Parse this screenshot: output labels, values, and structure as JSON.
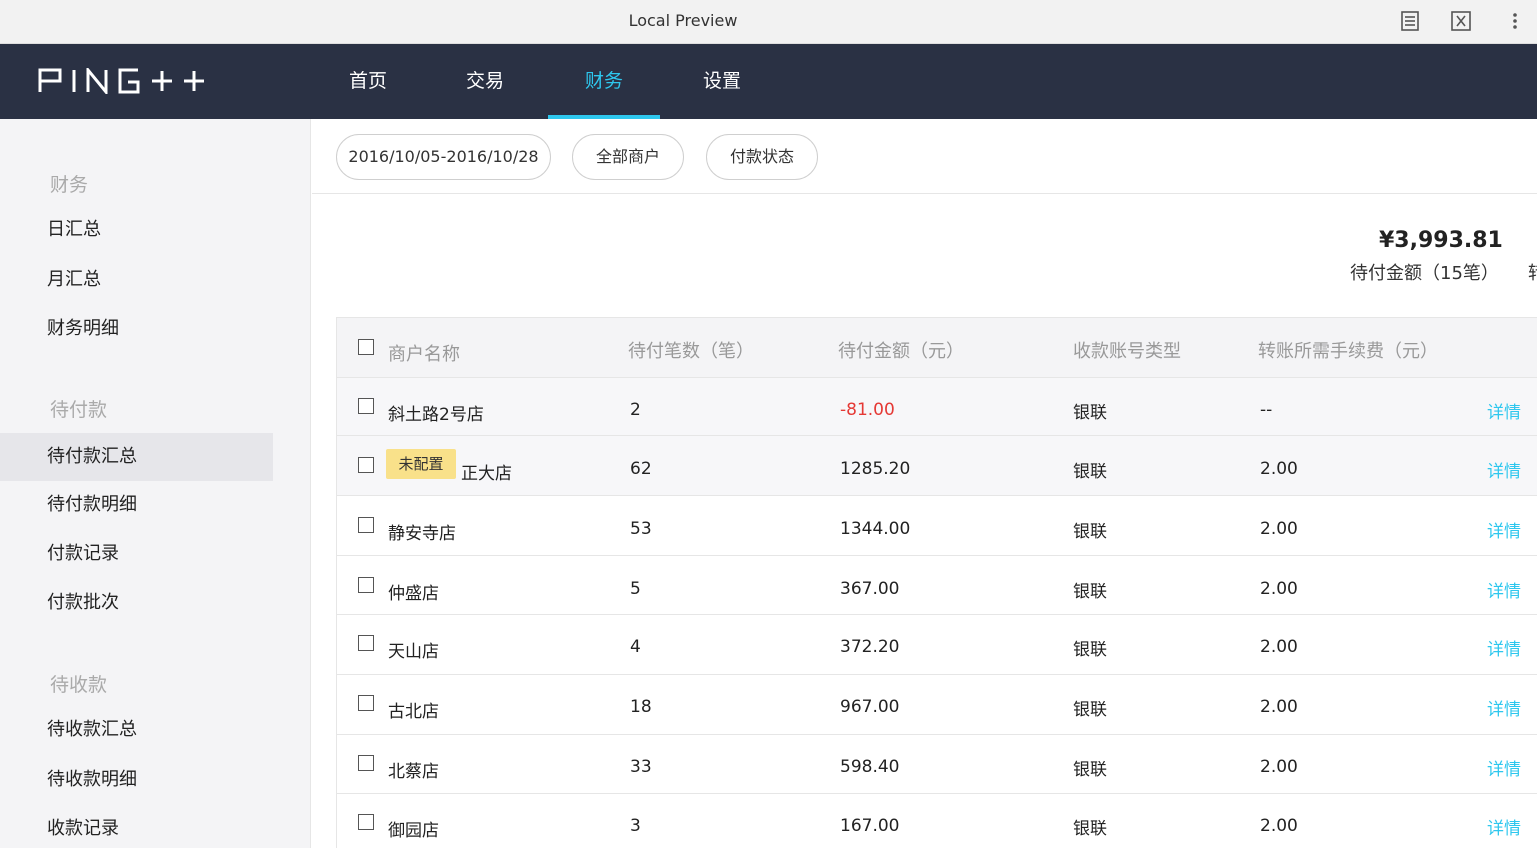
{
  "browser": {
    "title": "Local Preview",
    "icons": [
      "reader-mode-icon",
      "formula-icon",
      "more-vert-icon"
    ]
  },
  "header": {
    "logo_text": "PING++",
    "nav": [
      {
        "label": "首页",
        "active": false
      },
      {
        "label": "交易",
        "active": false
      },
      {
        "label": "财务",
        "active": true
      },
      {
        "label": "设置",
        "active": false
      }
    ]
  },
  "sidebar": {
    "groups": [
      {
        "title": "财务",
        "items": [
          {
            "label": "日汇总"
          },
          {
            "label": "月汇总"
          },
          {
            "label": "财务明细"
          }
        ]
      },
      {
        "title": "待付款",
        "items": [
          {
            "label": "待付款汇总",
            "active": true
          },
          {
            "label": "待付款明细"
          },
          {
            "label": "付款记录"
          },
          {
            "label": "付款批次"
          }
        ]
      },
      {
        "title": "待收款",
        "items": [
          {
            "label": "待收款汇总"
          },
          {
            "label": "待收款明细"
          },
          {
            "label": "收款记录"
          }
        ]
      }
    ]
  },
  "filters": {
    "date_range": "2016/10/05-2016/10/28",
    "merchant": "全部商户",
    "status": "付款状态"
  },
  "summary": {
    "amount": "¥3,993.81",
    "label": "待付金额（15笔）",
    "clipped_next": "转账笔"
  },
  "table": {
    "headers": [
      "商户名称",
      "待付笔数（笔）",
      "待付金额（元）",
      "收款账号类型",
      "转账所需手续费（元）"
    ],
    "rows": [
      {
        "tag": "",
        "name": "斜土路2号店",
        "count": "2",
        "amount": "-81.00",
        "negative": true,
        "account_type": "银联",
        "fee": "--",
        "action": "详情"
      },
      {
        "tag": "未配置",
        "name": "正大店",
        "count": "62",
        "amount": "1285.20",
        "negative": false,
        "account_type": "银联",
        "fee": "2.00",
        "action": "详情"
      },
      {
        "tag": "",
        "name": "静安寺店",
        "count": "53",
        "amount": "1344.00",
        "negative": false,
        "account_type": "银联",
        "fee": "2.00",
        "action": "详情"
      },
      {
        "tag": "",
        "name": "仲盛店",
        "count": "5",
        "amount": "367.00",
        "negative": false,
        "account_type": "银联",
        "fee": "2.00",
        "action": "详情"
      },
      {
        "tag": "",
        "name": "天山店",
        "count": "4",
        "amount": "372.20",
        "negative": false,
        "account_type": "银联",
        "fee": "2.00",
        "action": "详情"
      },
      {
        "tag": "",
        "name": "古北店",
        "count": "18",
        "amount": "967.00",
        "negative": false,
        "account_type": "银联",
        "fee": "2.00",
        "action": "详情"
      },
      {
        "tag": "",
        "name": "北蔡店",
        "count": "33",
        "amount": "598.40",
        "negative": false,
        "account_type": "银联",
        "fee": "2.00",
        "action": "详情"
      },
      {
        "tag": "",
        "name": "御园店",
        "count": "3",
        "amount": "167.00",
        "negative": false,
        "account_type": "银联",
        "fee": "2.00",
        "action": "详情"
      }
    ]
  },
  "colors": {
    "header_bg": "#2a3144",
    "accent": "#2ec7ee",
    "negative": "#e53935",
    "tag_bg": "#f9e18a"
  }
}
